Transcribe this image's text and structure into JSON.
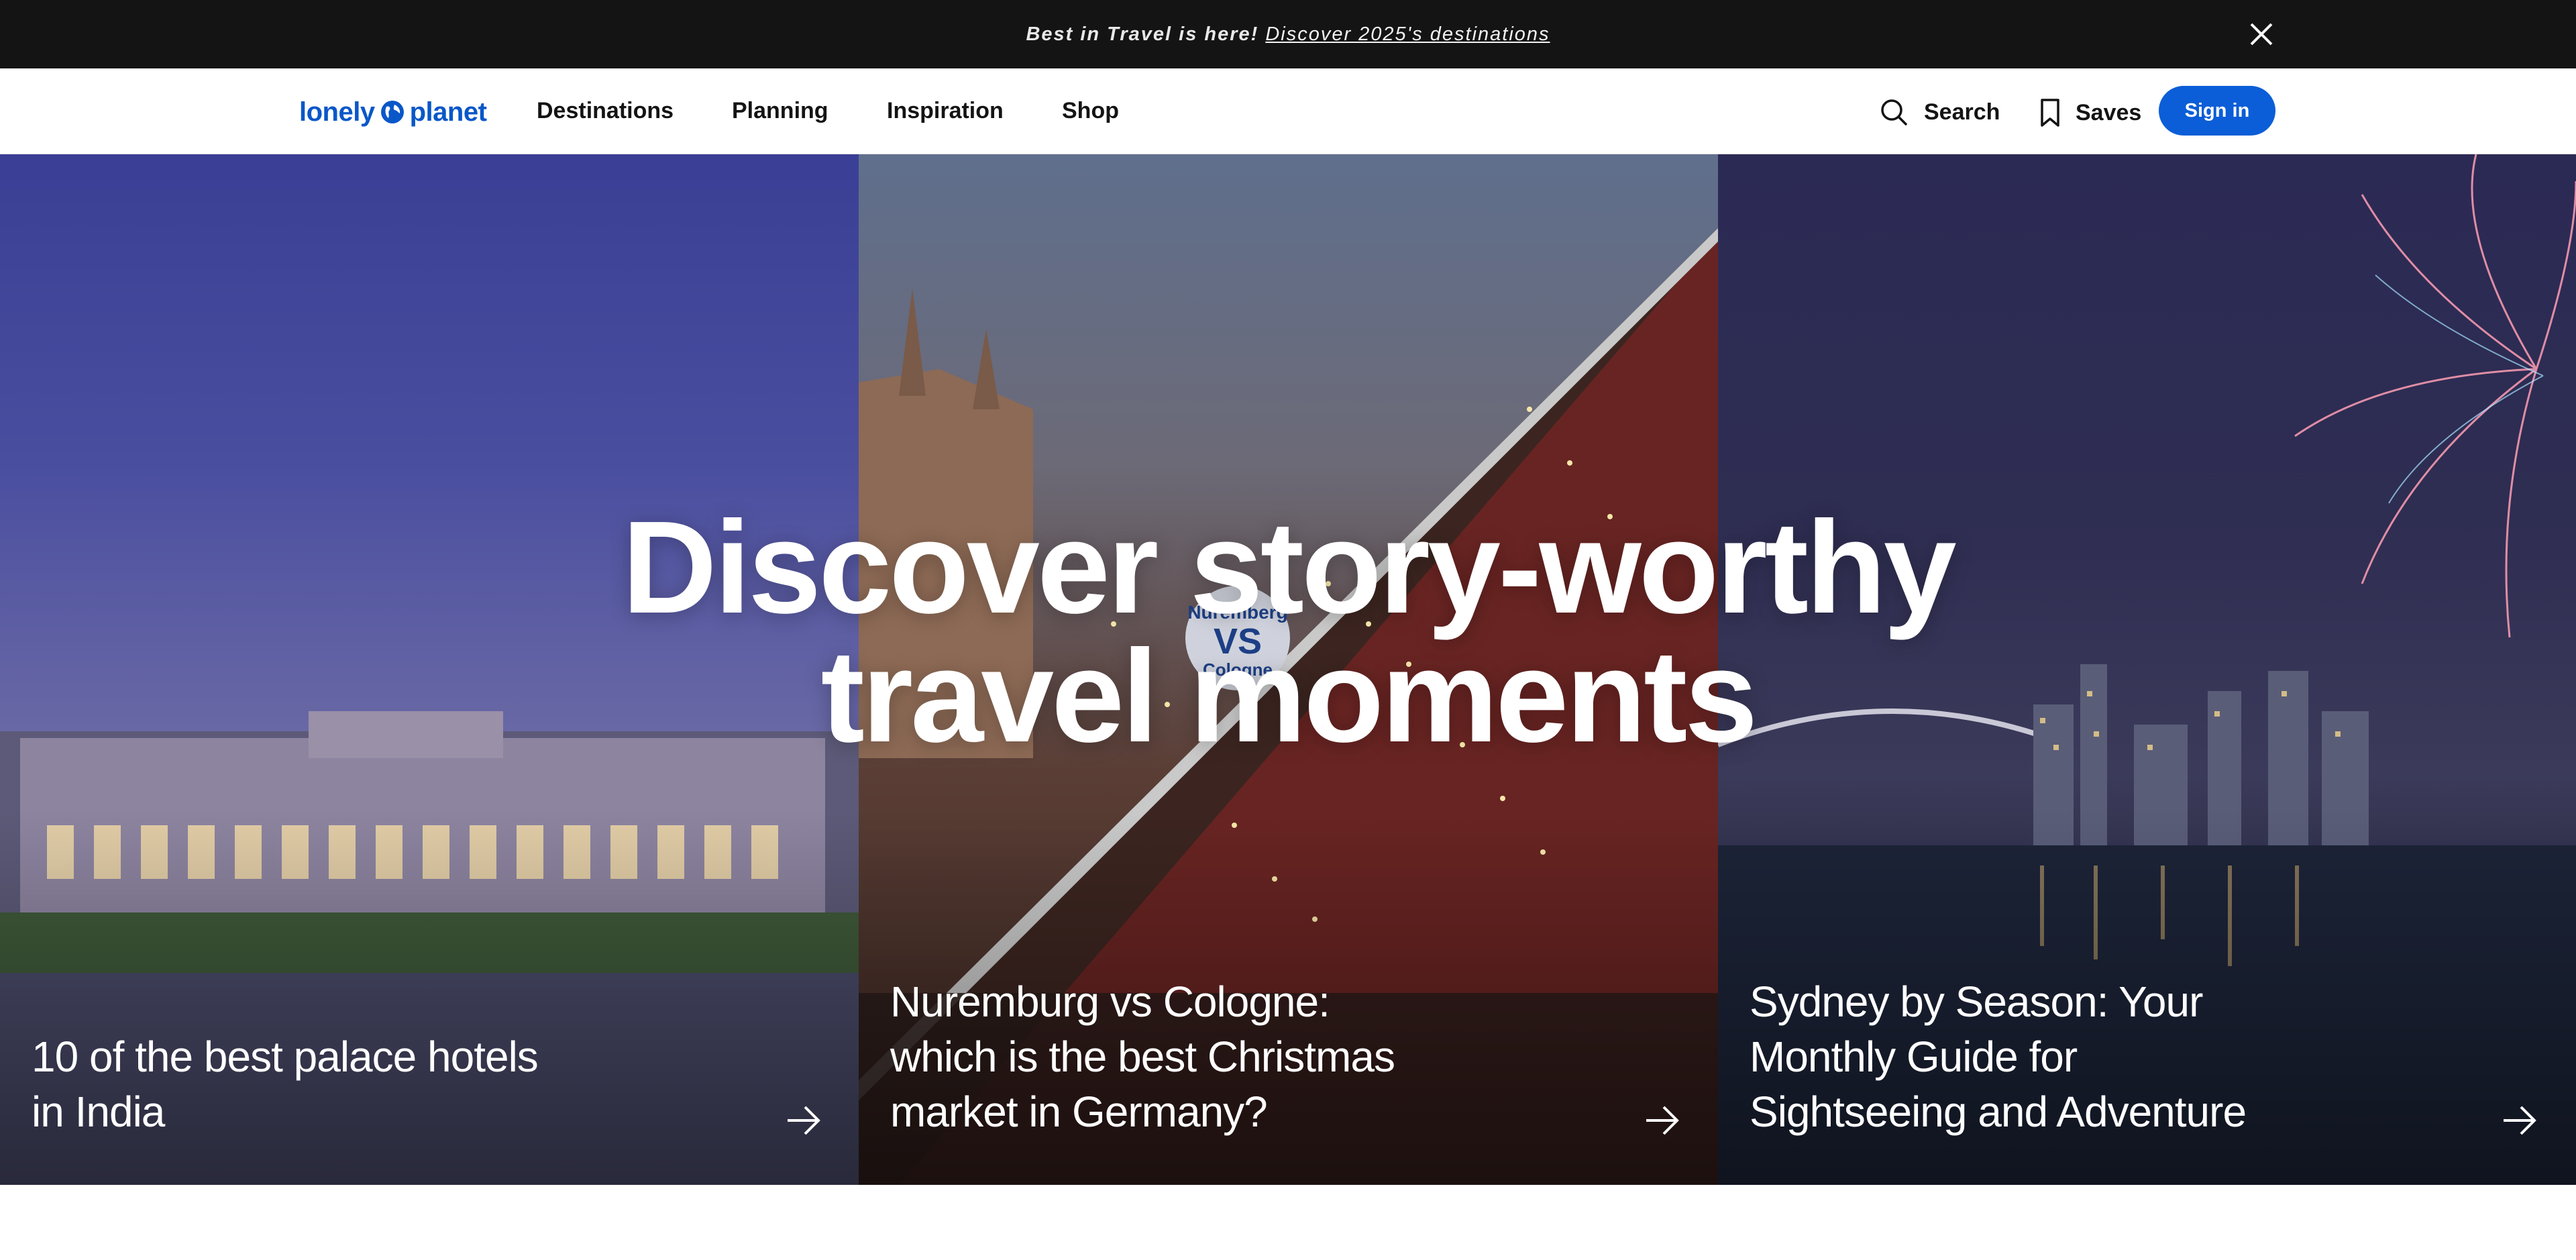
{
  "announcement": {
    "text": "Best in Travel is here!",
    "link": "Discover 2025's destinations",
    "close_icon": "close-icon"
  },
  "nav": {
    "logo_left": "lonely",
    "logo_right": "planet",
    "items": [
      "Destinations",
      "Planning",
      "Inspiration",
      "Shop"
    ],
    "search_label": "Search",
    "saves_label": "Saves",
    "signin_label": "Sign in",
    "accent": "#0b5ed7"
  },
  "hero": {
    "headline_line1": "Discover story-worthy",
    "headline_line2": "travel moments",
    "badge_top": "Nuremberg",
    "badge_mid": "VS",
    "badge_bottom": "Cologne",
    "cards": [
      {
        "title_lines": [
          "10 of the best palace hotels",
          "in India"
        ],
        "arrow_icon": "arrow-right-icon"
      },
      {
        "title_lines": [
          "Nuremburg vs Cologne:",
          "which is the best Christmas",
          "market in Germany?"
        ],
        "arrow_icon": "arrow-right-icon"
      },
      {
        "title_lines": [
          "Sydney by Season: Your",
          "Monthly Guide for",
          "Sightseeing and Adventure"
        ],
        "arrow_icon": "arrow-right-icon"
      }
    ]
  }
}
